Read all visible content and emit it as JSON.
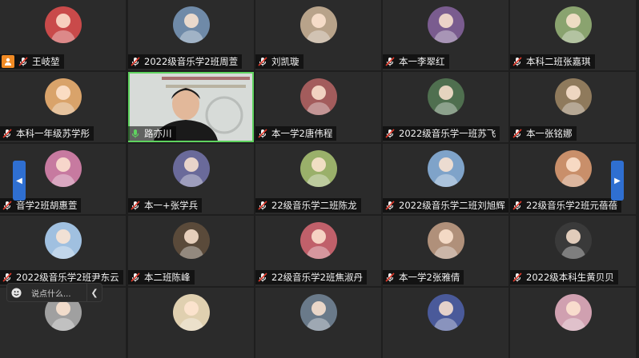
{
  "meeting": {
    "participants": [
      {
        "name": "王岐堃",
        "host": true
      },
      {
        "name": "2022级音乐学2班周萱"
      },
      {
        "name": "刘凯璇"
      },
      {
        "name": "本一李翠红"
      },
      {
        "name": "本科二班张嘉琪"
      },
      {
        "name": "本科一年级苏学彤"
      },
      {
        "name": "路亦川",
        "video": true,
        "speaking": true
      },
      {
        "name": "本一学2唐伟程"
      },
      {
        "name": "2022级音乐学一班苏飞"
      },
      {
        "name": "本一张铭娜"
      },
      {
        "name": "音学2班胡惠萱"
      },
      {
        "name": "本一+张学兵"
      },
      {
        "name": "22级音乐学二班陈龙"
      },
      {
        "name": "2022级音乐学二班刘旭辉"
      },
      {
        "name": "22级音乐学2班元蓓蓓"
      },
      {
        "name": "2022级音乐学2班尹东云"
      },
      {
        "name": "本二班陈峰"
      },
      {
        "name": "22级音乐学2班焦淑丹"
      },
      {
        "name": "本一学2张雅倩"
      },
      {
        "name": "2022级本科生黄贝贝"
      }
    ]
  },
  "chat": {
    "placeholder": "说点什么...",
    "emoji_icon": "smiley-icon",
    "collapse_icon": "chevron-left-icon"
  },
  "nav": {
    "prev_icon": "chevron-left-icon",
    "next_icon": "chevron-right-icon"
  },
  "colors": {
    "accent": "#2f6fd1",
    "host_badge": "#f08a24",
    "speaking_outline": "#5fd35f",
    "mic_red": "#e0392b"
  }
}
